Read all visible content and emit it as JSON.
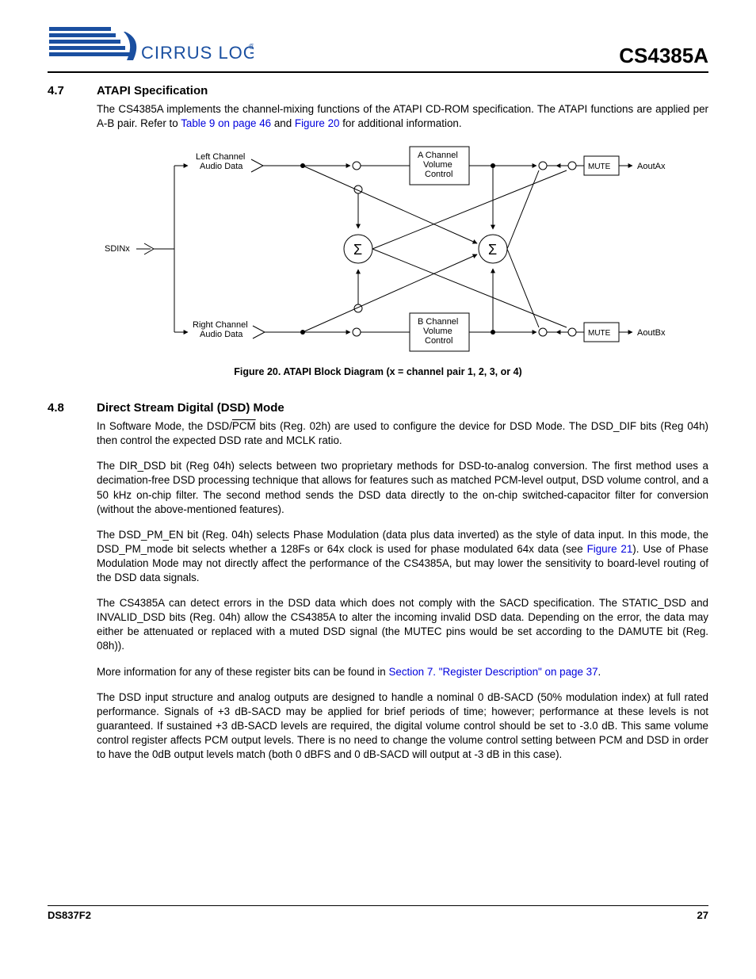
{
  "header": {
    "logo_text": "CIRRUS LOGIC",
    "logo_mark": "®",
    "part_number": "CS4385A"
  },
  "section47": {
    "num": "4.7",
    "title": "ATAPI Specification",
    "p1_a": "The CS4385A implements the channel-mixing functions of the ATAPI CD-ROM specification. The ATAPI functions are applied per A-B pair. Refer to ",
    "link1": "Table 9 on page 46",
    "p1_b": " and ",
    "link2": "Figure 20",
    "p1_c": " for additional information."
  },
  "figure20": {
    "caption": "Figure 20.  ATAPI Block Diagram (x = channel pair 1, 2, 3, or 4)",
    "sdinx": "SDINx",
    "left_audio": "Left Channel\nAudio Data",
    "right_audio": "Right Channel\nAudio Data",
    "a_vol": "A Channel\nVolume\nControl",
    "b_vol": "B Channel\nVolume\nControl",
    "sigma": "Σ",
    "mute": "MUTE",
    "aoutax": "AoutAx",
    "aoutbx": "AoutBx"
  },
  "section48": {
    "num": "4.8",
    "title": "Direct Stream Digital (DSD) Mode",
    "p1_a": "In Software Mode, the DSD/",
    "p1_pcm": "PCM",
    "p1_b": " bits (Reg. 02h) are used to configure the device for DSD Mode. The DSD_DIF bits (Reg 04h) then control the expected DSD rate and MCLK ratio.",
    "p2": "The DIR_DSD bit (Reg 04h) selects between two proprietary methods for DSD-to-analog conversion. The first method uses a decimation-free DSD processing technique that allows for features such as matched PCM-level output, DSD volume control, and a 50 kHz on-chip filter. The second method sends the DSD data directly to the on-chip switched-capacitor filter for conversion (without the above-mentioned features).",
    "p3_a": "The DSD_PM_EN bit (Reg. 04h) selects Phase Modulation (data plus data inverted) as the style of data input. In this mode, the DSD_PM_mode bit selects whether a 128Fs or 64x clock is used for phase modulated 64x data (see ",
    "p3_link": "Figure 21",
    "p3_b": "). Use of Phase Modulation Mode may not directly affect the performance of the CS4385A, but may lower the sensitivity to board-level routing of the DSD data signals.",
    "p4": "The CS4385A can detect errors in the DSD data which does not comply with the SACD specification. The STATIC_DSD and INVALID_DSD bits (Reg. 04h) allow the CS4385A to alter the incoming invalid DSD data. Depending on the error, the data may either be attenuated or replaced with a muted DSD signal (the MUTEC pins would be set according to the DAMUTE bit (Reg. 08h)).",
    "p5_a": "More information for any of these register bits can be found in ",
    "p5_link": "Section 7. \"Register Description\" on page 37",
    "p5_b": ".",
    "p6": "The DSD input structure and analog outputs are designed to handle a nominal 0 dB-SACD (50% modulation index) at full rated performance. Signals of +3 dB-SACD may be applied for brief periods of time; however; performance at these levels is not guaranteed. If sustained +3 dB-SACD levels are required, the digital volume control should be set to -3.0 dB. This same volume control register affects PCM output levels. There is no need to change the volume control setting between PCM and DSD in order to have the 0dB output levels match (both 0 dBFS and 0 dB-SACD will output at -3 dB in this case)."
  },
  "footer": {
    "left": "DS837F2",
    "right": "27"
  }
}
